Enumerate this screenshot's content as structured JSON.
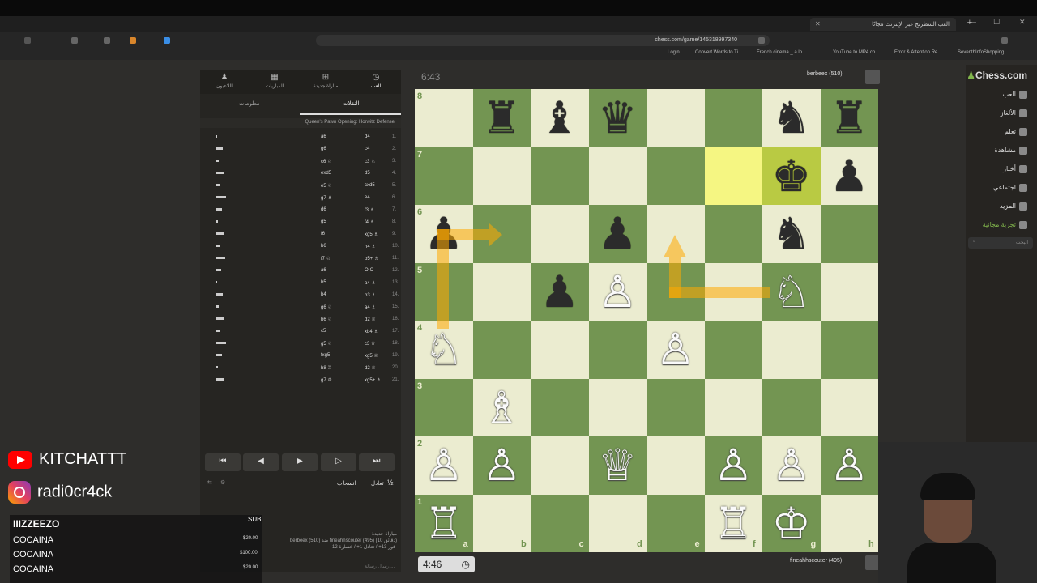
{
  "browser": {
    "tab_title": "العب الشطرنج عبر الإنترنت مجانًا",
    "url": "chess.com/game/145318997340",
    "bookmarks": [
      "Login",
      "Convert Words to Ti...",
      "French cinema _ a lo...",
      "YouTube to MP4 co...",
      "Error & Attention Re...",
      "SeventhInfoShopping..."
    ]
  },
  "left_panel": {
    "nav_tabs": [
      "اللاعبون",
      "المباريات",
      "مباراة جديدة",
      "العب"
    ],
    "subtabs": [
      "معلومات",
      "النقلات"
    ],
    "opening": "Queen's Pawn Opening: Horwitz Defense",
    "moves": [
      {
        "n": "1.",
        "w": "d4",
        "b": "a6"
      },
      {
        "n": "2.",
        "w": "c4",
        "b": "g6"
      },
      {
        "n": "3.",
        "w": "c3 ♘",
        "b": "c6 ♘"
      },
      {
        "n": "4.",
        "w": "d5",
        "b": "exd5"
      },
      {
        "n": "5.",
        "w": "cxd5",
        "b": "e5 ♘"
      },
      {
        "n": "6.",
        "w": "e4",
        "b": "g7 ♗"
      },
      {
        "n": "7.",
        "w": "f3 ♗",
        "b": "d6"
      },
      {
        "n": "8.",
        "w": "f4 ♗",
        "b": "g5"
      },
      {
        "n": "9.",
        "w": "xg5 ♗",
        "b": "f6"
      },
      {
        "n": "10.",
        "w": "h4 ♗",
        "b": "b6"
      },
      {
        "n": "11.",
        "w": "b5+ ♗",
        "b": "f7 ♘"
      },
      {
        "n": "12.",
        "w": "O-O",
        "b": "a6"
      },
      {
        "n": "13.",
        "w": "a4 ♗",
        "b": "b5"
      },
      {
        "n": "14.",
        "w": "b3 ♗",
        "b": "b4"
      },
      {
        "n": "15.",
        "w": "a4 ♗",
        "b": "g6 ♘"
      },
      {
        "n": "16.",
        "w": "d2 ♕",
        "b": "b6 ♘"
      },
      {
        "n": "17.",
        "w": "xb4 ♗",
        "b": "c5"
      },
      {
        "n": "18.",
        "w": "c3 ♕",
        "b": "g5 ♘"
      },
      {
        "n": "19.",
        "w": "xg5 ♕",
        "b": "fxg5"
      },
      {
        "n": "20.",
        "w": "d2 ♕",
        "b": "b8 ♖"
      },
      {
        "n": "21.",
        "w": "xg5+ ♗",
        "b": "g7 ♔"
      }
    ],
    "controls": [
      "⏮",
      "◀",
      "▶",
      "▷",
      "⏭"
    ],
    "draw_label": "تعادل",
    "draw_half": "½",
    "resign_label": "انسحاب",
    "game_info": [
      "مباراة جديدة",
      "berbeex (510) ضد fineahhscouter (495) (10 دقائق)",
      "فوز 13+ / تعادل 1+ / خسارة 12-"
    ],
    "chat_placeholder": "إرسال رسالة..."
  },
  "board": {
    "top_clock": "6:43",
    "bottom_clock": "4:46",
    "top_player": "berbeex (510)",
    "bottom_player": "fineahhscouter (495)",
    "files": [
      "a",
      "b",
      "c",
      "d",
      "e",
      "f",
      "g",
      "h"
    ],
    "ranks": [
      "8",
      "7",
      "6",
      "5",
      "4",
      "3",
      "2",
      "1"
    ],
    "pieces": [
      {
        "sq": "b8",
        "p": "♜",
        "c": "b"
      },
      {
        "sq": "c8",
        "p": "♝",
        "c": "b"
      },
      {
        "sq": "d8",
        "p": "♛",
        "c": "b"
      },
      {
        "sq": "g8",
        "p": "♞",
        "c": "b"
      },
      {
        "sq": "h8",
        "p": "♜",
        "c": "b"
      },
      {
        "sq": "g7",
        "p": "♚",
        "c": "b"
      },
      {
        "sq": "h7",
        "p": "♟",
        "c": "b"
      },
      {
        "sq": "a6",
        "p": "♟",
        "c": "b"
      },
      {
        "sq": "d6",
        "p": "♟",
        "c": "b"
      },
      {
        "sq": "g6",
        "p": "♞",
        "c": "b"
      },
      {
        "sq": "c5",
        "p": "♟",
        "c": "b"
      },
      {
        "sq": "d5",
        "p": "♙",
        "c": "w"
      },
      {
        "sq": "g5",
        "p": "♘",
        "c": "w"
      },
      {
        "sq": "a4",
        "p": "♘",
        "c": "w"
      },
      {
        "sq": "e4",
        "p": "♙",
        "c": "w"
      },
      {
        "sq": "b3",
        "p": "♗",
        "c": "w"
      },
      {
        "sq": "a2",
        "p": "♙",
        "c": "w"
      },
      {
        "sq": "b2",
        "p": "♙",
        "c": "w"
      },
      {
        "sq": "d2",
        "p": "♕",
        "c": "w"
      },
      {
        "sq": "f2",
        "p": "♙",
        "c": "w"
      },
      {
        "sq": "g2",
        "p": "♙",
        "c": "w"
      },
      {
        "sq": "h2",
        "p": "♙",
        "c": "w"
      },
      {
        "sq": "a1",
        "p": "♖",
        "c": "w"
      },
      {
        "sq": "f1",
        "p": "♖",
        "c": "w"
      },
      {
        "sq": "g1",
        "p": "♔",
        "c": "w"
      }
    ],
    "highlights": [
      "f7",
      "g7"
    ]
  },
  "sidebar": {
    "logo": "Chess.com",
    "items": [
      "العب",
      "الألغاز",
      "تعلم",
      "مشاهدة",
      "أخبار",
      "اجتماعي",
      "المزيد",
      "تجربة مجانية"
    ],
    "search_placeholder": "البحث"
  },
  "stream_overlay": {
    "youtube": "KITCHATTT",
    "instagram": "radi0cr4ck",
    "sub_name": "IIIZZEEZO",
    "sub_badge": "SUB",
    "donations": [
      {
        "name": "COCAINA",
        "amount": "$20.00"
      },
      {
        "name": "COCAINA",
        "amount": "$100.00"
      },
      {
        "name": "COCAINA",
        "amount": "$20.00"
      }
    ]
  },
  "colors": {
    "light_square": "#ebecd0",
    "dark_square": "#739552",
    "arrow": "#ffaa00",
    "accent": "#81b64c"
  }
}
